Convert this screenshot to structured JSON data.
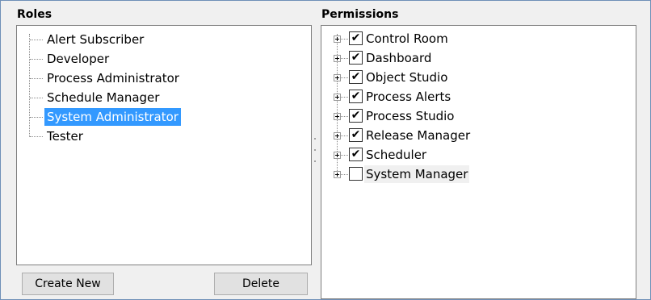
{
  "roles": {
    "title": "Roles",
    "items": [
      {
        "label": "Alert Subscriber",
        "selected": false
      },
      {
        "label": "Developer",
        "selected": false
      },
      {
        "label": "Process Administrator",
        "selected": false
      },
      {
        "label": "Schedule Manager",
        "selected": false
      },
      {
        "label": "System Administrator",
        "selected": true
      },
      {
        "label": "Tester",
        "selected": false
      }
    ],
    "create_label": "Create New",
    "delete_label": "Delete"
  },
  "permissions": {
    "title": "Permissions",
    "items": [
      {
        "label": "Control Room",
        "checked": true
      },
      {
        "label": "Dashboard",
        "checked": true
      },
      {
        "label": "Object Studio",
        "checked": true
      },
      {
        "label": "Process Alerts",
        "checked": true
      },
      {
        "label": "Process Studio",
        "checked": true
      },
      {
        "label": "Release Manager",
        "checked": true
      },
      {
        "label": "Scheduler",
        "checked": true
      },
      {
        "label": "System Manager",
        "checked": false
      }
    ]
  },
  "colors": {
    "selection": "#3399ff",
    "frame_border": "#6f8fb7",
    "panel_background": "#f0f0f0"
  },
  "icons": {
    "expander": "plus-box-icon",
    "check": "check-mark-icon"
  }
}
